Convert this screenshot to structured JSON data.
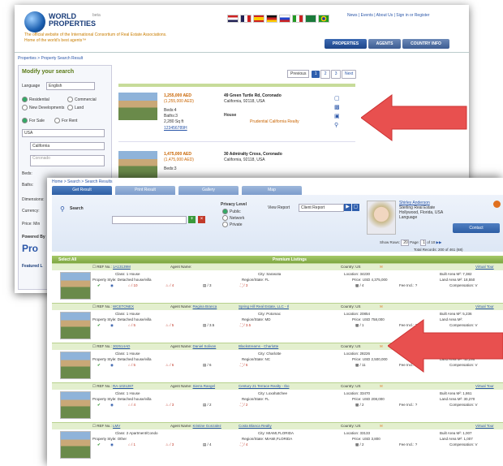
{
  "back": {
    "logo_line1": "WORLD",
    "logo_line2": "PROPERTIES",
    "logo_beta": "beta",
    "tagline1": "The official website of the International Consortium of Real Estate Associations.",
    "tagline2": "Home of the world's best agents™",
    "top_links": "News | Events | About Us | Sign in or Register",
    "nav": [
      "PROPERTIES",
      "AGENTS",
      "COUNTRY INFO"
    ],
    "breadcrumb": "Properties > Property Search Result",
    "sidebar_title": "Modify your search",
    "language_label": "Language",
    "language_value": "English",
    "radios": [
      "Residential",
      "Commercial",
      "New Developments",
      "Land"
    ],
    "sale_rent": [
      "For Sale",
      "For Rent"
    ],
    "country": "USA",
    "state": "California",
    "city_placeholder": "Coronado",
    "fields": [
      "Beds:",
      "Baths:",
      "Dimensions:",
      "Currency:",
      "Price: Min"
    ],
    "powered_by": "Powered By",
    "featured": "Featured L",
    "paging": {
      "prev": "Previous",
      "pages": [
        "1",
        "2",
        "3"
      ],
      "next": "Next"
    },
    "listings": [
      {
        "price1": "1,255,000 AED",
        "price2": "(1,255,000 AED)",
        "title": "49 Green Turtle Rd, Coronado",
        "location": "California, 92118, USA",
        "details": [
          "Beds:4",
          "Baths:3",
          "2,280 Sq ft"
        ],
        "id": "123456789H",
        "type": "House",
        "agency": "Prudential California Realty"
      },
      {
        "price1": "1,475,000 AED",
        "price2": "(1,475,000 AED)",
        "title": "30 Admiralty Cross, Coronado",
        "location": "California, 92118, USA",
        "details": [
          "Beds:3"
        ]
      }
    ]
  },
  "front": {
    "breadcrumb": "Home > Search > Search Results",
    "tabs": [
      "Get Result",
      "Print Result",
      "Gallery",
      "Map"
    ],
    "search_label": "Search",
    "privacy_label": "Privacy Level",
    "privacy_options": [
      "Public",
      "Network",
      "Private"
    ],
    "view_report_label": "View Report",
    "view_report_value": "Client Report",
    "agent": {
      "name": "Shirley Anderson",
      "company": "Sterling Real Estate",
      "location": "Hollywood, Florida, USA",
      "language": "Language",
      "contact": "Contact"
    },
    "show_rows_label": "Show Rows:",
    "show_rows_value": "20",
    "page_label": "Page:",
    "page_value": "1",
    "page_of": "of",
    "page_total": "10",
    "total_records": "Total Records: 200 of 461 (68)",
    "select_all": "Select All",
    "premium": "Premium Listings",
    "listings": [
      {
        "ref": "1A13139M",
        "agent": "",
        "agency": "",
        "country": "US",
        "tour": "Virtual Tour",
        "klass": "1 House",
        "city": "Sarasota",
        "location": "34230",
        "area1": "7,382",
        "style": "Detached house/villa",
        "region": "FL",
        "price": "USD 4,375,000",
        "area2": "18,550",
        "beds": "10",
        "baths": "4",
        "rooms": "3",
        "photos": "4",
        "fee": "?",
        "comp": "V"
      },
      {
        "ref": "WCETONEX",
        "agent": "Regina Branca",
        "agency": "Spring Hill Real Estate, LLC - Il",
        "country": "US",
        "tour": "Virtual Tour",
        "klass": "1 House",
        "city": "Potomac",
        "location": "20854",
        "area1": "5,236",
        "style": "Detached house/villa",
        "region": "MD",
        "price": "USD 758,000",
        "area2": "",
        "beds": "5",
        "baths": "5",
        "rooms": "3.5",
        "photos": "1",
        "fee": "?",
        "comp": "V"
      },
      {
        "ref": "302514AD",
        "agent": "Daniel Solivan",
        "agency": "Blackstreams - Charlotte",
        "country": "US",
        "tour": "Virtual Tour",
        "klass": "1 House",
        "city": "Charlotte",
        "location": "28226",
        "area1": "12,840",
        "style": "Detached house/villa",
        "region": "NC",
        "price": "USD 2,500,000",
        "area2": "48,296",
        "beds": "5",
        "baths": "6",
        "rooms": "6",
        "photos": "11",
        "fee": "?",
        "comp": "V"
      },
      {
        "ref": "RA-1021287",
        "agent": "Sierra Rangel",
        "agency": "Century 21 Terrace Realty - Ibo",
        "country": "US",
        "tour": "Virtual Tour",
        "klass": "1 House",
        "city": "Loxahatchee",
        "location": "33470",
        "area1": "1,861",
        "style": "Detached house/villa",
        "region": "FL",
        "price": "USD 208,000",
        "area2": "30,270",
        "beds": "4",
        "baths": "3",
        "rooms": "2",
        "photos": "2",
        "fee": "?",
        "comp": "V"
      },
      {
        "ref": "LMV",
        "agent": "Kristine Gonzalez",
        "agency": "Costa Blanca Realty",
        "country": "US",
        "tour": "Virtual Tour",
        "klass": "2 Apartment/Condo",
        "city": "MIAMI,FLORIDA",
        "location": "33133",
        "area1": "1,007",
        "style": "Other",
        "region": "MIAMI,FLORIDA",
        "price": "USD 3,800",
        "area2": "1,007",
        "beds": "1",
        "baths": "3",
        "rooms": "4",
        "photos": "2",
        "fee": "?",
        "comp": "V"
      }
    ]
  },
  "colors": {
    "arrow": "#e8504f",
    "accent": "#2f5fae",
    "green": "#7ea742"
  }
}
